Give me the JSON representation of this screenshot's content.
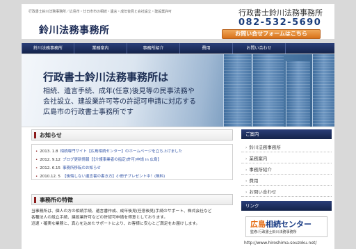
{
  "header": {
    "tagline": "行政書士鈴川法務事務所／広島市・廿日市市の相続・遺言・成年後見と会社設立・建設業許可",
    "logo": "鈴川法務事務所",
    "office_name": "行政書士鈴川法務事務所",
    "phone": "082-532-5690",
    "contact_button": "お問い合せフォームはこちら"
  },
  "nav": {
    "items": [
      {
        "label": "鈴川法務事務所"
      },
      {
        "label": "業務案内"
      },
      {
        "label": "事務所紹介"
      },
      {
        "label": "費用"
      },
      {
        "label": "お問い合わせ"
      }
    ]
  },
  "hero": {
    "title": "行政書士鈴川法務事務所は",
    "lines": [
      "相続、遺言手続、成年(任意)後見等の民事法務や",
      "会社設立、建設業許可等の許認可申請に対応する",
      "広島市の行政書士事務所です"
    ]
  },
  "news": {
    "heading": "お知らせ",
    "items": [
      {
        "date": "2013. 1.8",
        "title": "相続専門サイト【広島相続センター】のホームページを立ち上げました"
      },
      {
        "date": "2012. 9.12",
        "title": "ブログ更新情報【【介護事業者の指定(許可)申請 in 広島】"
      },
      {
        "date": "2012. 6.15",
        "title": "事務所移転のお知らせ"
      },
      {
        "date": "2010.12. 5",
        "title": "【後悔しない遺言書の書き方】小冊子プレゼント中！(無料)"
      }
    ]
  },
  "features": {
    "heading": "事務所の特徴",
    "lines": [
      "当事務所は、個人の方の相続手続、遺言書作成、成年後見(任意後見)手続のサポート、株式会社など",
      "各種法人の設立手続、建設業許可などの許認可申請を得意としております。",
      "迅速・確実な業務と、真心を込めたサポートにより、お客様に安心とご満足をお届けします。"
    ]
  },
  "sidebar": {
    "guide_heading": "ご案内",
    "guide_items": [
      {
        "label": "鈴川法務事務所"
      },
      {
        "label": "業務案内"
      },
      {
        "label": "事務所紹介"
      },
      {
        "label": "費用"
      },
      {
        "label": "お問い合わせ"
      }
    ],
    "link_heading": "リンク",
    "banner_name_a": "広島",
    "banner_name_b": "相続センター",
    "banner_sub": "監修:行政書士鈴川法務事務所",
    "banner_url": "http://www.hiroshima-souzoku.net/"
  }
}
